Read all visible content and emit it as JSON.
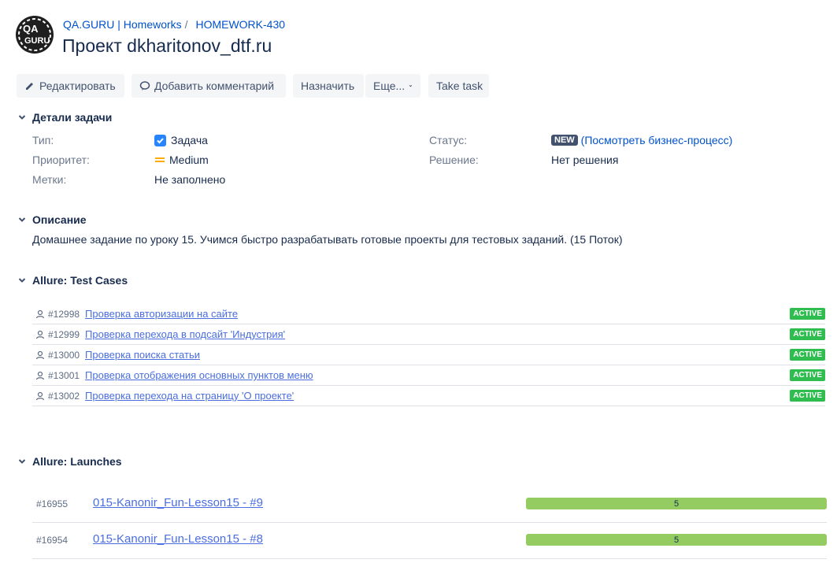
{
  "header": {
    "breadcrumbs": [
      {
        "label": "QA.GURU | Homeworks"
      },
      {
        "label": "HOMEWORK-430"
      }
    ],
    "title": "Проект dkharitonov_dtf.ru"
  },
  "toolbar": {
    "edit": "Редактировать",
    "comment": "Добавить комментарий",
    "assign": "Назначить",
    "more": "Еще...",
    "take_task": "Take task"
  },
  "details": {
    "heading": "Детали задачи",
    "type_label": "Тип:",
    "type_value": "Задача",
    "priority_label": "Приоритет:",
    "priority_value": "Medium",
    "labels_label": "Метки:",
    "labels_value": "Не заполнено",
    "status_label": "Статус:",
    "status_badge": "NEW",
    "status_link": "(Посмотреть бизнес-процесс)",
    "resolution_label": "Решение:",
    "resolution_value": "Нет решения"
  },
  "description": {
    "heading": "Описание",
    "text": "Домашнее задание по уроку 15. Учимся быстро разрабатывать готовые проекты для тестовых заданий. (15 Поток)"
  },
  "test_cases": {
    "heading": "Allure: Test Cases",
    "items": [
      {
        "id": "#12998",
        "title": "Проверка авторизации на сайте",
        "status": "ACTIVE"
      },
      {
        "id": "#12999",
        "title": "Проверка перехода в подсайт 'Индустрия'",
        "status": "ACTIVE"
      },
      {
        "id": "#13000",
        "title": "Проверка поиска статьи",
        "status": "ACTIVE"
      },
      {
        "id": "#13001",
        "title": "Проверка отображения основных пунктов меню",
        "status": "ACTIVE"
      },
      {
        "id": "#13002",
        "title": "Проверка перехода на страницу 'О проекте'",
        "status": "ACTIVE"
      }
    ]
  },
  "launches": {
    "heading": "Allure: Launches",
    "items": [
      {
        "id": "#16955",
        "title": "015-Kanonir_Fun-Lesson15 - #9",
        "passed": "5",
        "progress": 1.0
      },
      {
        "id": "#16954",
        "title": "015-Kanonir_Fun-Lesson15 - #8",
        "passed": "5",
        "progress": 1.0
      }
    ]
  },
  "colors": {
    "link": "#0052cc",
    "active_badge": "#2ebd4e",
    "progress_fill": "#94cc62",
    "new_badge": "#42526e"
  }
}
